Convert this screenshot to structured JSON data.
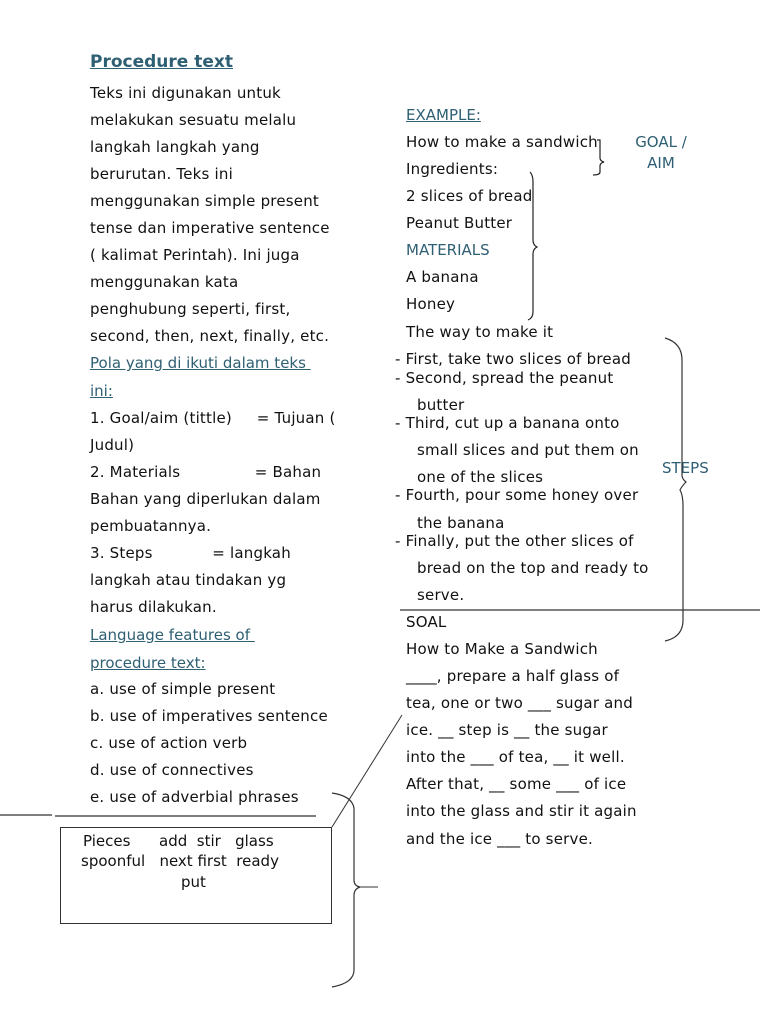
{
  "left": {
    "title": "Procedure text",
    "intro_lines": [
      "Teks ini digunakan untuk",
      "melakukan sesuatu melalu",
      "langkah langkah yang",
      "berurutan. Teks ini",
      "menggunakan simple present",
      "tense dan imperative sentence",
      "( kalimat Perintah). Ini juga",
      "menggunakan kata",
      "penghubung seperti, first,",
      "second, then, next, finally, etc."
    ],
    "pattern_heading": [
      "Pola yang di ikuti dalam teks ",
      "ini:"
    ],
    "pattern_lines": [
      "1. Goal/aim (tittle)     = Tujuan (",
      "Judul)",
      "2. Materials               = Bahan",
      "Bahan yang diperlukan dalam",
      "pembuatannya.",
      "3. Steps            = langkah",
      "langkah atau tindakan yg",
      "harus dilakukan."
    ],
    "features_heading": [
      "Language features of ",
      "procedure text:"
    ],
    "features": [
      "a. use of simple present",
      "b. use of imperatives sentence",
      "c. use of action verb",
      "d. use of connectives",
      "e. use of adverbial phrases"
    ]
  },
  "word_box": {
    "lines": [
      "Pieces      add  stir   glass",
      "spoonful   next first  ready",
      "put"
    ]
  },
  "right": {
    "example_heading": "EXAMPLE:",
    "goal_title": "How to make a sandwich",
    "ingredients_label": "Ingredients:",
    "ingredients": [
      "2 slices of bread",
      "Peanut Butter"
    ],
    "materials_label": "MATERIALS",
    "materials": [
      "A banana",
      "Honey"
    ],
    "way_label": "The way to make it",
    "steps": [
      {
        "first": "- First, take two slices of bread",
        "cont": []
      },
      {
        "first": "- Second, spread the peanut",
        "cont": [
          "butter"
        ]
      },
      {
        "first": "- Third, cut up a banana onto",
        "cont": [
          "small slices and put them on",
          "one of the slices"
        ]
      },
      {
        "first": "- Fourth, pour some honey over",
        "cont": [
          "the banana"
        ]
      },
      {
        "first": "- Finally, put the other slices of",
        "cont": [
          "bread on the top and ready to",
          "serve."
        ]
      }
    ],
    "annotations": {
      "goal_aim": [
        "GOAL /",
        "AIM"
      ],
      "steps": "STEPS"
    },
    "soal_label": "SOAL",
    "soal_title": "How to Make a Sandwich",
    "soal_lines": [
      "____, prepare a half glass of",
      "tea, one or two ___ sugar and",
      "ice. __ step is __ the sugar",
      "into the ___ of tea, __ it well.",
      "After that, __ some ___ of ice",
      "into the glass and stir it again",
      "and the ice ___ to serve."
    ]
  },
  "colors": {
    "heading_teal": "#2e5f73",
    "text": "#111111"
  }
}
